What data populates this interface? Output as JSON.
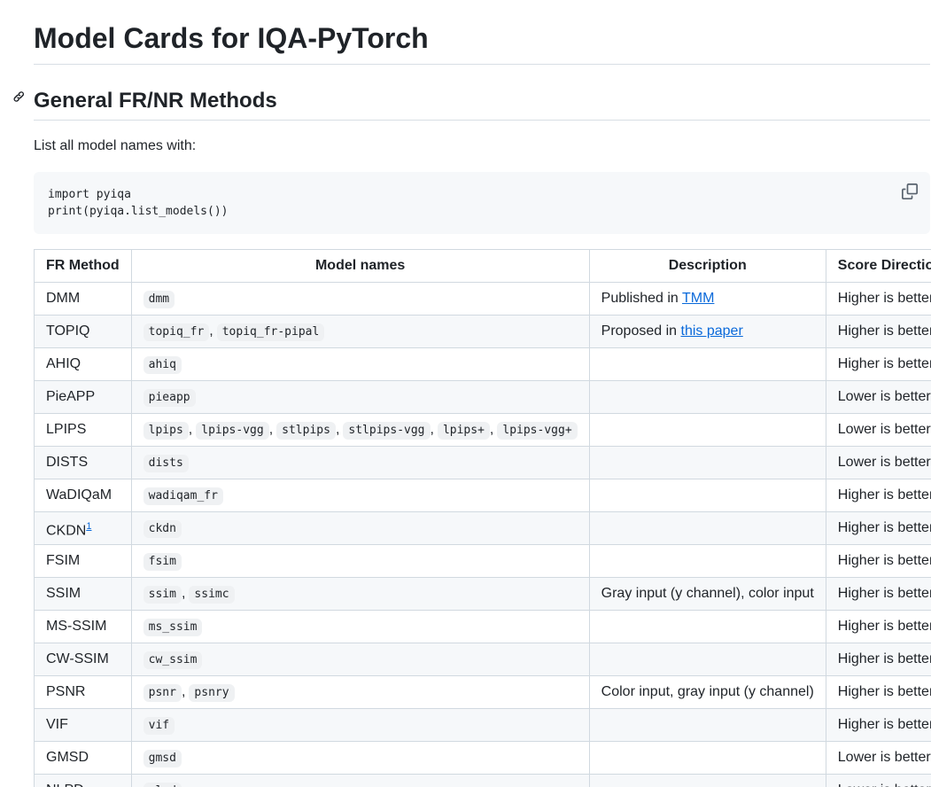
{
  "page": {
    "title": "Model Cards for IQA-PyTorch",
    "section_title": "General FR/NR Methods",
    "lead": "List all model names with:",
    "code_lines": [
      "import pyiqa",
      "print(pyiqa.list_models())"
    ]
  },
  "table": {
    "headers": [
      "FR Method",
      "Model names",
      "Description",
      "Score Direction"
    ],
    "rows": [
      {
        "method": "DMM",
        "models": [
          "dmm"
        ],
        "description": "Published in ",
        "link": "TMM",
        "direction": "Higher is better"
      },
      {
        "method": "TOPIQ",
        "models": [
          "topiq_fr",
          "topiq_fr-pipal"
        ],
        "description": "Proposed in ",
        "link": "this paper",
        "direction": "Higher is better"
      },
      {
        "method": "AHIQ",
        "models": [
          "ahiq"
        ],
        "description": "",
        "direction": "Higher is better"
      },
      {
        "method": "PieAPP",
        "models": [
          "pieapp"
        ],
        "description": "",
        "direction": "Lower is better"
      },
      {
        "method": "LPIPS",
        "models": [
          "lpips",
          "lpips-vgg",
          "stlpips",
          "stlpips-vgg",
          "lpips+",
          "lpips-vgg+"
        ],
        "description": "",
        "direction": "Lower is better"
      },
      {
        "method": "DISTS",
        "models": [
          "dists"
        ],
        "description": "",
        "direction": "Lower is better"
      },
      {
        "method": "WaDIQaM",
        "models": [
          "wadiqam_fr"
        ],
        "description": "",
        "direction": "Higher is better"
      },
      {
        "method": "CKDN",
        "footnote": "1",
        "models": [
          "ckdn"
        ],
        "description": "",
        "direction": "Higher is better"
      },
      {
        "method": "FSIM",
        "models": [
          "fsim"
        ],
        "description": "",
        "direction": "Higher is better"
      },
      {
        "method": "SSIM",
        "models": [
          "ssim",
          "ssimc"
        ],
        "description": "Gray input (y channel), color input",
        "direction": "Higher is better"
      },
      {
        "method": "MS-SSIM",
        "models": [
          "ms_ssim"
        ],
        "description": "",
        "direction": "Higher is better"
      },
      {
        "method": "CW-SSIM",
        "models": [
          "cw_ssim"
        ],
        "description": "",
        "direction": "Higher is better"
      },
      {
        "method": "PSNR",
        "models": [
          "psnr",
          "psnry"
        ],
        "description": "Color input, gray input (y channel)",
        "direction": "Higher is better"
      },
      {
        "method": "VIF",
        "models": [
          "vif"
        ],
        "description": "",
        "direction": "Higher is better"
      },
      {
        "method": "GMSD",
        "models": [
          "gmsd"
        ],
        "description": "",
        "direction": "Lower is better"
      },
      {
        "method": "NLPD",
        "models": [
          "nlpd"
        ],
        "description": "",
        "direction": "Lower is better"
      }
    ]
  },
  "icons": {
    "anchor": "link-icon",
    "copy": "copy-icon"
  },
  "colors": {
    "link": "#0969da",
    "text": "#1f2328",
    "code_bg": "#f6f8fa",
    "border": "#d1d9e0"
  }
}
